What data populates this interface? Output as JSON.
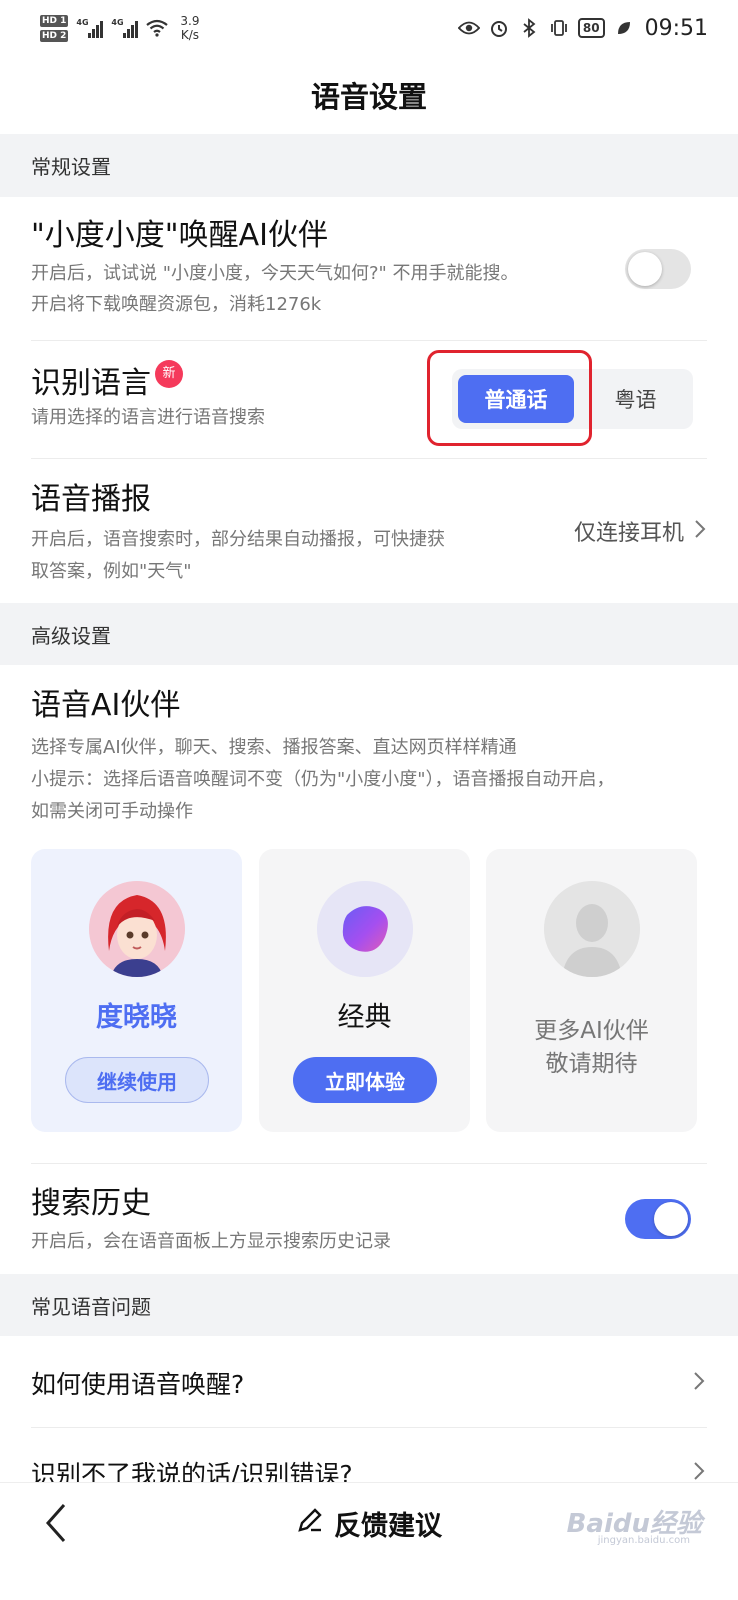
{
  "status_bar": {
    "sim1": "HD 1",
    "sim2": "HD 2",
    "net1": "4G",
    "net2": "4G",
    "speed_value": "3.9",
    "speed_unit": "K/s",
    "battery": "80",
    "time": "09:51",
    "icons": [
      "eye-icon",
      "alarm-icon",
      "bluetooth-icon",
      "vibrate-icon",
      "battery-icon",
      "leaf-icon"
    ]
  },
  "header": {
    "title": "语音设置"
  },
  "sections": {
    "general": "常规设置",
    "advanced": "高级设置",
    "faq": "常见语音问题"
  },
  "wake": {
    "title": "\"小度小度\"唤醒AI伙伴",
    "desc1": "开启后，试试说 \"小度小度，今天天气如何?\" 不用手就能搜。",
    "desc2": "开启将下载唤醒资源包，消耗1276k",
    "enabled": false
  },
  "language": {
    "title": "识别语言",
    "badge": "新",
    "desc": "请用选择的语言进行语音搜索",
    "options": [
      "普通话",
      "粤语"
    ],
    "selected": "普通话"
  },
  "broadcast": {
    "title": "语音播报",
    "desc1": "开启后，语音搜索时，部分结果自动播报，可快捷获",
    "desc2": "取答案，例如\"天气\"",
    "value": "仅连接耳机"
  },
  "ai_partner": {
    "title": "语音AI伙伴",
    "desc1": "选择专属AI伙伴，聊天、搜索、播报答案、直达网页样样精通",
    "desc2": "小提示：选择后语音唤醒词不变（仍为\"小度小度\"），语音播报自动开启，",
    "desc3": "如需关闭可手动操作",
    "cards": [
      {
        "name": "度晓晓",
        "button": "继续使用",
        "selected": true
      },
      {
        "name": "经典",
        "button": "立即体验",
        "selected": false
      },
      {
        "line1": "更多AI伙伴",
        "line2": "敬请期待"
      }
    ]
  },
  "history": {
    "title": "搜索历史",
    "desc": "开启后，会在语音面板上方显示搜索历史记录",
    "enabled": true
  },
  "faq": [
    "如何使用语音唤醒?",
    "识别不了我说的话/识别错误?"
  ],
  "bottom": {
    "feedback": "反馈建议",
    "watermark": "Baidu经验",
    "watermark_sub": "jingyan.baidu.com"
  },
  "colors": {
    "accent": "#4e6ef2",
    "highlight": "#e0232e",
    "badge": "#f53a5b",
    "section_bg": "#f2f3f5"
  }
}
